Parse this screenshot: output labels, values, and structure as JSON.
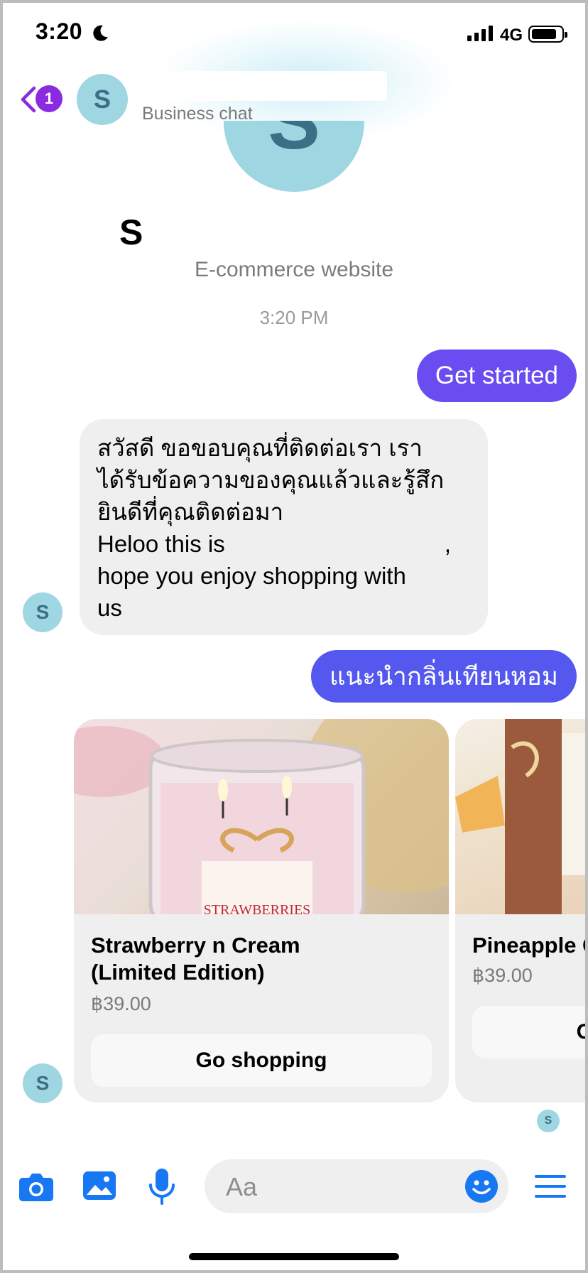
{
  "status_bar": {
    "time": "3:20",
    "network": "4G"
  },
  "header": {
    "back_badge_count": "1",
    "avatar_letter": "S",
    "subtitle": "Business chat"
  },
  "profile": {
    "avatar_letter": "S",
    "name": "S",
    "category": "E-commerce website",
    "timestamp": "3:20 PM"
  },
  "messages": {
    "outgoing_1": "Get started",
    "incoming_1": {
      "thai_line_1": "สวัสดี ขอขอบคุณที่ติดต่อเรา เรา",
      "thai_line_2": "ได้รับข้อความของคุณแล้วและรู้สึก",
      "thai_line_3": "ยินดีที่คุณติดต่อมา",
      "en_line_1": "Heloo this is",
      "en_line_1_tail": ",",
      "en_line_2": "hope you enjoy shopping with",
      "en_line_3": "us"
    },
    "incoming_avatar_letter": "S",
    "outgoing_2": "แนะนำกลิ่นเทียนหอม"
  },
  "carousel": {
    "cards": [
      {
        "title_line_1": "Strawberry n Cream",
        "title_line_2": "(Limited Edition)",
        "price": "฿39.00",
        "button": "Go shopping",
        "label_text": "STRAWBERRIES"
      },
      {
        "title": "Pineapple C",
        "price": "฿39.00",
        "button": "G"
      }
    ],
    "avatar_letter": "S",
    "read_receipt_letter": "S"
  },
  "composer": {
    "placeholder": "Aa"
  },
  "colors": {
    "accent_purple": "#6a4df0",
    "accent_blue": "#1877f2",
    "avatar_bg": "#9ed6e2",
    "bubble_incoming": "#efefef",
    "badge": "#8a2be2"
  },
  "icons": [
    "moon-icon",
    "signal-icon",
    "battery-icon",
    "back-chevron-icon",
    "camera-icon",
    "photo-icon",
    "microphone-icon",
    "emoji-icon",
    "menu-icon"
  ]
}
